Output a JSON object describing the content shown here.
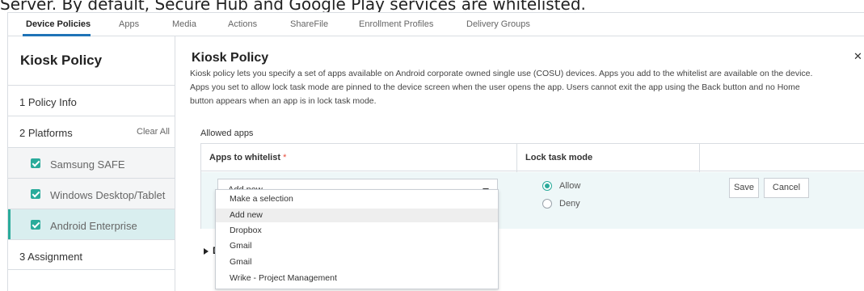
{
  "caption": "Server. By default, Secure Hub and Google Play services are whitelisted.",
  "tabs": [
    {
      "label": "Device Policies",
      "active": true
    },
    {
      "label": "Apps"
    },
    {
      "label": "Media"
    },
    {
      "label": "Actions"
    },
    {
      "label": "ShareFile"
    },
    {
      "label": "Enrollment Profiles"
    },
    {
      "label": "Delivery Groups"
    }
  ],
  "sidebar": {
    "title": "Kiosk Policy",
    "policy_info": "1 Policy Info",
    "platforms": "2 Platforms",
    "clear_all": "Clear All",
    "platform_items": [
      {
        "label": "Samsung SAFE",
        "checked": true
      },
      {
        "label": "Windows Desktop/Tablet",
        "checked": true
      },
      {
        "label": "Android Enterprise",
        "checked": true,
        "active": true
      }
    ],
    "assignment": "3 Assignment"
  },
  "main": {
    "title": "Kiosk Policy",
    "description": "Kiosk policy lets you specify a set of apps available on Android corporate owned single use (COSU) devices. Apps you add to the whitelist are available on the device. Apps you set to allow lock task mode are pinned to the device screen when the user opens the app. Users cannot exit the app using the Back button and no Home button appears when an app is in lock task mode.",
    "close_icon": "close-icon",
    "allowed_apps_label": "Allowed apps",
    "table": {
      "col_apps": "Apps to whitelist",
      "required_mark": "*",
      "col_lock": "Lock task mode"
    },
    "select_value": "Add new",
    "lock_options": [
      {
        "label": "Allow",
        "selected": true
      },
      {
        "label": "Deny",
        "selected": false
      }
    ],
    "save_label": "Save",
    "cancel_label": "Cancel",
    "dropdown_options": [
      {
        "label": "Make a selection"
      },
      {
        "label": "Add new",
        "highlighted": true
      },
      {
        "label": "Dropbox"
      },
      {
        "label": "Gmail"
      },
      {
        "label": "Gmail"
      },
      {
        "label": "Wrike - Project Management"
      }
    ],
    "collapsed_section_prefix": "D"
  },
  "colors": {
    "accent": "#2aab9b",
    "tab_underline": "#1f73b7",
    "active_row": "#d9eeef",
    "table_body": "#eef7f8"
  }
}
